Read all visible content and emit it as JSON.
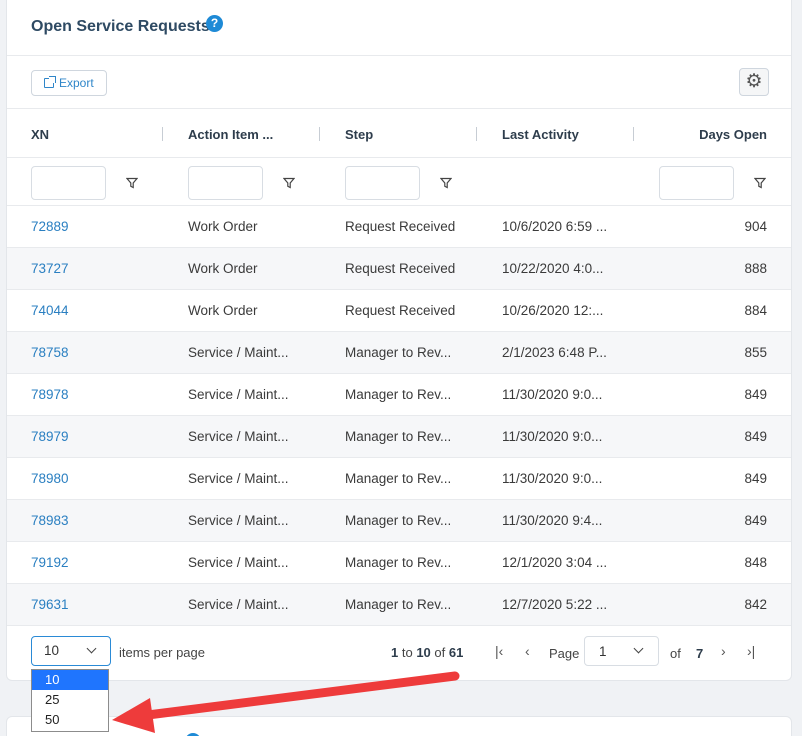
{
  "panel": {
    "title": "Open Service Requests",
    "help_glyph": "?"
  },
  "toolbar": {
    "export_label": "Export",
    "settings_icon": "gear-icon"
  },
  "columns": [
    "XN",
    "Action Item ...",
    "Step",
    "Last Activity",
    "Days Open"
  ],
  "rows": [
    {
      "xn": "72889",
      "action": "Work Order",
      "step": "Request Received",
      "last": "10/6/2020 6:59 ...",
      "days": "904"
    },
    {
      "xn": "73727",
      "action": "Work Order",
      "step": "Request Received",
      "last": "10/22/2020 4:0...",
      "days": "888"
    },
    {
      "xn": "74044",
      "action": "Work Order",
      "step": "Request Received",
      "last": "10/26/2020 12:...",
      "days": "884"
    },
    {
      "xn": "78758",
      "action": "Service / Maint...",
      "step": "Manager to Rev...",
      "last": "2/1/2023 6:48 P...",
      "days": "855"
    },
    {
      "xn": "78978",
      "action": "Service / Maint...",
      "step": "Manager to Rev...",
      "last": "11/30/2020 9:0...",
      "days": "849"
    },
    {
      "xn": "78979",
      "action": "Service / Maint...",
      "step": "Manager to Rev...",
      "last": "11/30/2020 9:0...",
      "days": "849"
    },
    {
      "xn": "78980",
      "action": "Service / Maint...",
      "step": "Manager to Rev...",
      "last": "11/30/2020 9:0...",
      "days": "849"
    },
    {
      "xn": "78983",
      "action": "Service / Maint...",
      "step": "Manager to Rev...",
      "last": "11/30/2020 9:4...",
      "days": "849"
    },
    {
      "xn": "79192",
      "action": "Service / Maint...",
      "step": "Manager to Rev...",
      "last": "12/1/2020 3:04 ...",
      "days": "848"
    },
    {
      "xn": "79631",
      "action": "Service / Maint...",
      "step": "Manager to Rev...",
      "last": "12/7/2020 5:22 ...",
      "days": "842"
    }
  ],
  "pager": {
    "page_size": "10",
    "items_per_page_label": "items per page",
    "range_start": "1",
    "range_to": "to",
    "range_end": "10",
    "range_of": "of",
    "range_total": "61",
    "page_label": "Page",
    "current_page": "1",
    "of_label": "of",
    "total_pages": "7",
    "nav_first": "|‹",
    "nav_prev": "‹",
    "nav_next": "›",
    "nav_last": "›|"
  },
  "page_size_options": [
    "10",
    "25",
    "50"
  ],
  "colors": {
    "link": "#2a7fc1",
    "accent": "#1e8ad6",
    "selected_option": "#1f75fe",
    "annotation_arrow": "#ee3b3b"
  }
}
